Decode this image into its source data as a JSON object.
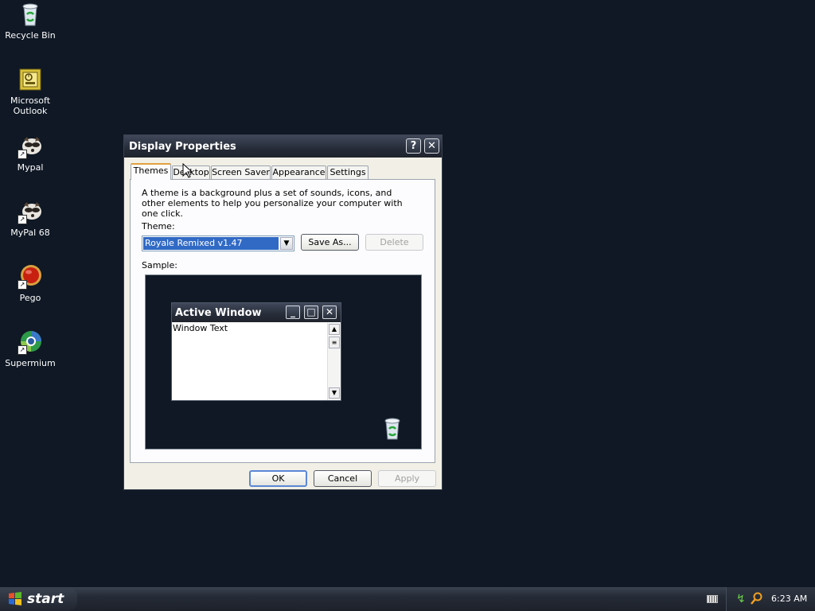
{
  "desktop": {
    "icons": [
      {
        "label": "Recycle Bin",
        "icon": "recycle-bin-icon"
      },
      {
        "label": "Microsoft Outlook",
        "icon": "outlook-icon"
      },
      {
        "label": "Mypal",
        "icon": "mypal-icon"
      },
      {
        "label": "MyPal 68",
        "icon": "mypal68-icon"
      },
      {
        "label": "Pego",
        "icon": "pego-icon"
      },
      {
        "label": "Supermium",
        "icon": "supermium-icon"
      }
    ]
  },
  "dialog": {
    "title": "Display Properties",
    "help_glyph": "?",
    "close_glyph": "✕",
    "tabs": [
      "Themes",
      "Desktop",
      "Screen Saver",
      "Appearance",
      "Settings"
    ],
    "active_tab": "Themes",
    "description": "A theme is a background plus a set of sounds, icons, and other elements to help you personalize your computer with one click.",
    "theme_label": "Theme:",
    "theme_value": "Royale Remixed v1.47",
    "save_as_label": "Save As...",
    "delete_label": "Delete",
    "sample_label": "Sample:",
    "sample": {
      "window_title": "Active Window",
      "window_text": "Window Text"
    },
    "ok_label": "OK",
    "cancel_label": "Cancel",
    "apply_label": "Apply"
  },
  "taskbar": {
    "start_label": "start",
    "clock": "6:23 AM"
  }
}
